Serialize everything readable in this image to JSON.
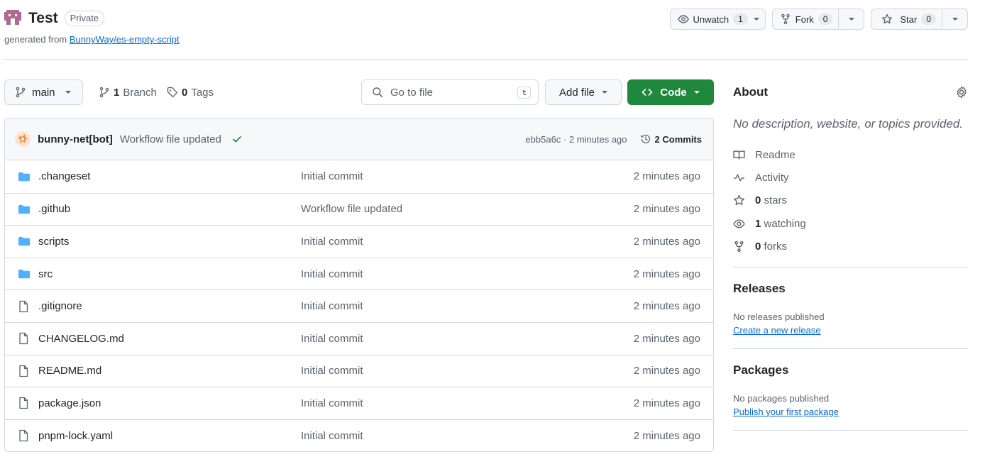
{
  "repo": {
    "name": "Test",
    "visibility": "Private",
    "generated_prefix": "generated from",
    "template_link": "BunnyWay/es-empty-script"
  },
  "header_buttons": {
    "watch": {
      "label": "Unwatch",
      "count": "1"
    },
    "fork": {
      "label": "Fork",
      "count": "0"
    },
    "star": {
      "label": "Star",
      "count": "0"
    }
  },
  "toolbar": {
    "branch": "main",
    "branches_count": "1",
    "branches_label": "Branch",
    "tags_count": "0",
    "tags_label": "Tags",
    "search_placeholder": "Go to file",
    "search_shortcut": "t",
    "add_file": "Add file",
    "code": "Code"
  },
  "latest_commit": {
    "author": "bunny-net[bot]",
    "message": "Workflow file updated",
    "sha": "ebb5a6c",
    "time": "2 minutes ago",
    "sha_time": "ebb5a6c · 2 minutes ago",
    "commits_count": "2 Commits"
  },
  "files": [
    {
      "type": "dir",
      "name": ".changeset",
      "message": "Initial commit",
      "time": "2 minutes ago"
    },
    {
      "type": "dir",
      "name": ".github",
      "message": "Workflow file updated",
      "time": "2 minutes ago"
    },
    {
      "type": "dir",
      "name": "scripts",
      "message": "Initial commit",
      "time": "2 minutes ago"
    },
    {
      "type": "dir",
      "name": "src",
      "message": "Initial commit",
      "time": "2 minutes ago"
    },
    {
      "type": "file",
      "name": ".gitignore",
      "message": "Initial commit",
      "time": "2 minutes ago"
    },
    {
      "type": "file",
      "name": "CHANGELOG.md",
      "message": "Initial commit",
      "time": "2 minutes ago"
    },
    {
      "type": "file",
      "name": "README.md",
      "message": "Initial commit",
      "time": "2 minutes ago"
    },
    {
      "type": "file",
      "name": "package.json",
      "message": "Initial commit",
      "time": "2 minutes ago"
    },
    {
      "type": "file",
      "name": "pnpm-lock.yaml",
      "message": "Initial commit",
      "time": "2 minutes ago"
    }
  ],
  "about": {
    "title": "About",
    "description": "No description, website, or topics provided.",
    "readme": "Readme",
    "activity": "Activity",
    "stars_count": "0",
    "stars_label": "stars",
    "watching_count": "1",
    "watching_label": "watching",
    "forks_count": "0",
    "forks_label": "forks"
  },
  "releases": {
    "title": "Releases",
    "empty": "No releases published",
    "link": "Create a new release"
  },
  "packages": {
    "title": "Packages",
    "empty": "No packages published",
    "link": "Publish your first package"
  },
  "colors": {
    "accent": "#0969da",
    "code_button": "#1f883d",
    "folder": "#54aeff",
    "check": "#1a7f37"
  }
}
